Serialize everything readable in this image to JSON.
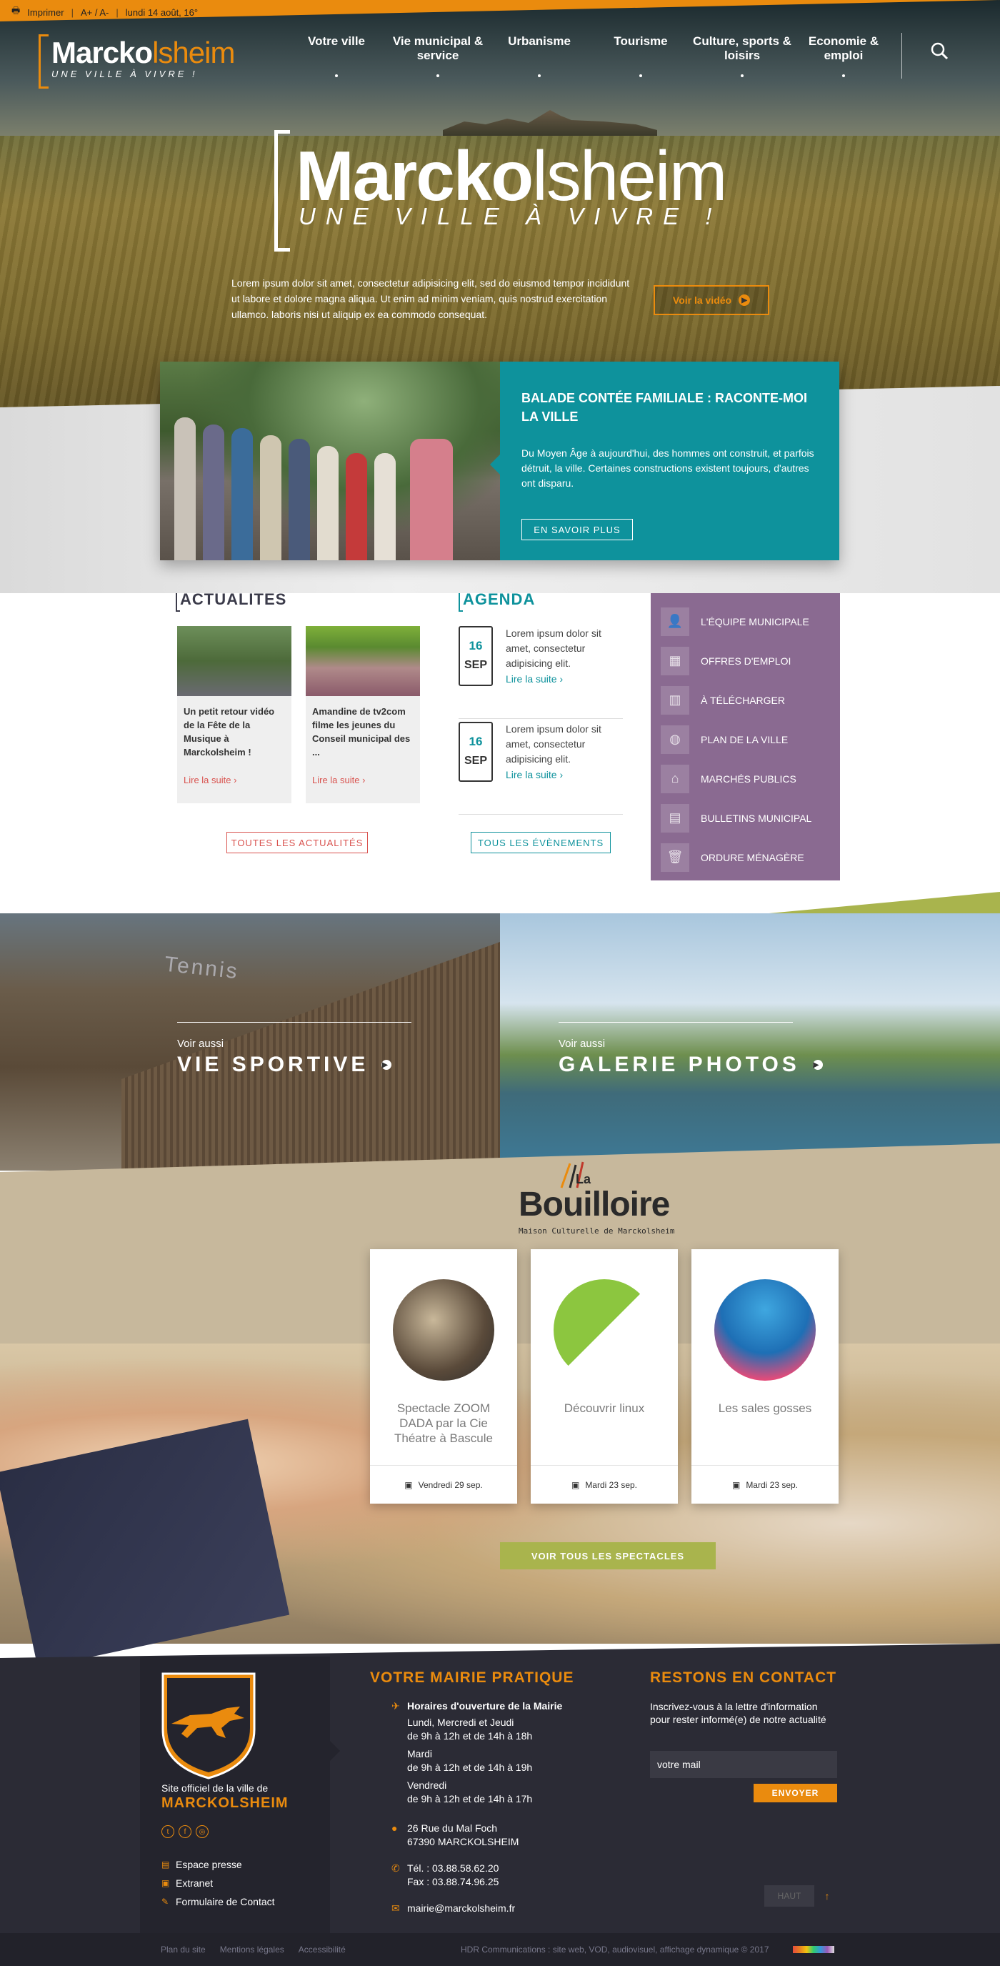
{
  "topbar": {
    "print": "Imprimer",
    "font": "A+ / A-",
    "date": "lundi 14 août, 16°"
  },
  "logo": {
    "part1": "Marcko",
    "part2": "lsheim",
    "tagline": "UNE VILLE À VIVRE !"
  },
  "nav": [
    {
      "label": "Votre ville"
    },
    {
      "label": "Vie municipal & service"
    },
    {
      "label": "Urbanisme"
    },
    {
      "label": "Tourisme"
    },
    {
      "label": "Culture, sports & loisirs"
    },
    {
      "label": "Economie & emploi"
    }
  ],
  "hero": {
    "brand1": "Marcko",
    "brand2": "lsheim",
    "tagline": "UNE VILLE À VIVRE !",
    "intro": "Lorem ipsum dolor sit amet, consectetur adipisicing elit, sed do eiusmod tempor incididunt ut labore et dolore magna aliqua. Ut enim ad minim veniam, quis nostrud exercitation ullamco. laboris nisi ut aliquip ex ea commodo consequat.",
    "video_button": "Voir la vidéo"
  },
  "feature": {
    "title": "BALADE CONTÉE FAMILIALE : RACONTE-MOI LA VILLE",
    "desc": "Du Moyen Âge à aujourd'hui, des hommes ont construit, et parfois détruit, la ville. Certaines constructions existent toujours, d'autres ont disparu.",
    "button": "EN SAVOIR PLUS"
  },
  "news": {
    "heading": "ACTUALITÉS",
    "items": [
      {
        "title": "Un petit retour vidéo de la Fête de la Musique à Marckolsheim !",
        "more": "Lire la suite"
      },
      {
        "title": "Amandine de tv2com filme les jeunes du Conseil municipal des ...",
        "more": "Lire la suite"
      }
    ],
    "all_button": "TOUTES LES ACTUALITÉS"
  },
  "agenda": {
    "heading": "AGENDA",
    "items": [
      {
        "day": "16",
        "month": "SEP",
        "text": "Lorem ipsum dolor sit amet, consectetur adipisicing elit.",
        "more": "Lire la suite"
      },
      {
        "day": "16",
        "month": "SEP",
        "text": "Lorem ipsum dolor sit amet, consectetur adipisicing elit.",
        "more": "Lire la suite"
      }
    ],
    "all_button": "TOUS LES ÉVÈNEMENTS"
  },
  "quicklinks": [
    {
      "label": "L'ÉQUIPE MUNICIPALE",
      "icon": "team-icon"
    },
    {
      "label": "OFFRES D'EMPLOI",
      "icon": "jobs-icon"
    },
    {
      "label": "À TÉLÉCHARGER",
      "icon": "download-icon"
    },
    {
      "label": "PLAN DE LA VILLE",
      "icon": "map-icon"
    },
    {
      "label": "MARCHÉS PUBLICS",
      "icon": "market-icon"
    },
    {
      "label": "BULLETINS MUNICIPAL",
      "icon": "bulletin-icon"
    },
    {
      "label": "ORDURE MÉNAGÈRE",
      "icon": "trash-icon"
    }
  ],
  "promos": [
    {
      "small": "Voir aussi",
      "big": "VIE SPORTIVE",
      "sign": "Tennis"
    },
    {
      "small": "Voir aussi",
      "big": "GALERIE PHOTOS"
    }
  ],
  "bouilloire": {
    "la": "La",
    "name": "Bouilloire",
    "sub": "Maison Culturelle de Marckolsheim"
  },
  "shows": [
    {
      "title": "Spectacle ZOOM DADA par la Cie Théatre à Bascule",
      "date": "Vendredi 29 sep."
    },
    {
      "title": "Découvrir linux",
      "date": "Mardi 23 sep."
    },
    {
      "title": "Les sales gosses",
      "date": "Mardi 23 sep."
    }
  ],
  "shows_button": "VOIR TOUS LES SPECTACLES",
  "footer": {
    "site_label": "Site officiel de la ville de",
    "town": "MARCKOLSHEIM",
    "links": [
      "Espace presse",
      "Extranet",
      "Formulaire de Contact"
    ],
    "mairie_heading": "VOTRE MAIRIE PRATIQUE",
    "hours_title": "Horaires d'ouverture de la Mairie",
    "hours": [
      "Lundi, Mercredi et Jeudi",
      "de 9h à 12h et de 14h à 18h",
      "Mardi",
      "de 9h à 12h et de 14h à 19h",
      "Vendredi",
      "de 9h à 12h et de 14h à 17h"
    ],
    "address1": "26 Rue du Mal Foch",
    "address2": "67390 MARCKOLSHEIM",
    "tel": "Tél. : 03.88.58.62.20",
    "fax": "Fax : 03.88.74.96.25",
    "email": "mairie@marckolsheim.fr",
    "contact_heading": "RESTONS EN CONTACT",
    "contact_text": "Inscrivez-vous à la lettre d'information pour rester informé(e) de notre actualité",
    "mail_placeholder": "votre mail",
    "send": "ENVOYER",
    "top": "HAUT"
  },
  "bottombar": {
    "links": [
      "Plan du site",
      "Mentions légales",
      "Accessibilité"
    ],
    "credit": "HDR Communications : site web, VOD, audiovisuel, affichage dynamique © 2017"
  },
  "colors": {
    "orange": "#ea8b0e",
    "teal": "#0e929c",
    "purple": "#8a6a91",
    "green": "#a9b44d",
    "dark": "#2b2b35"
  }
}
